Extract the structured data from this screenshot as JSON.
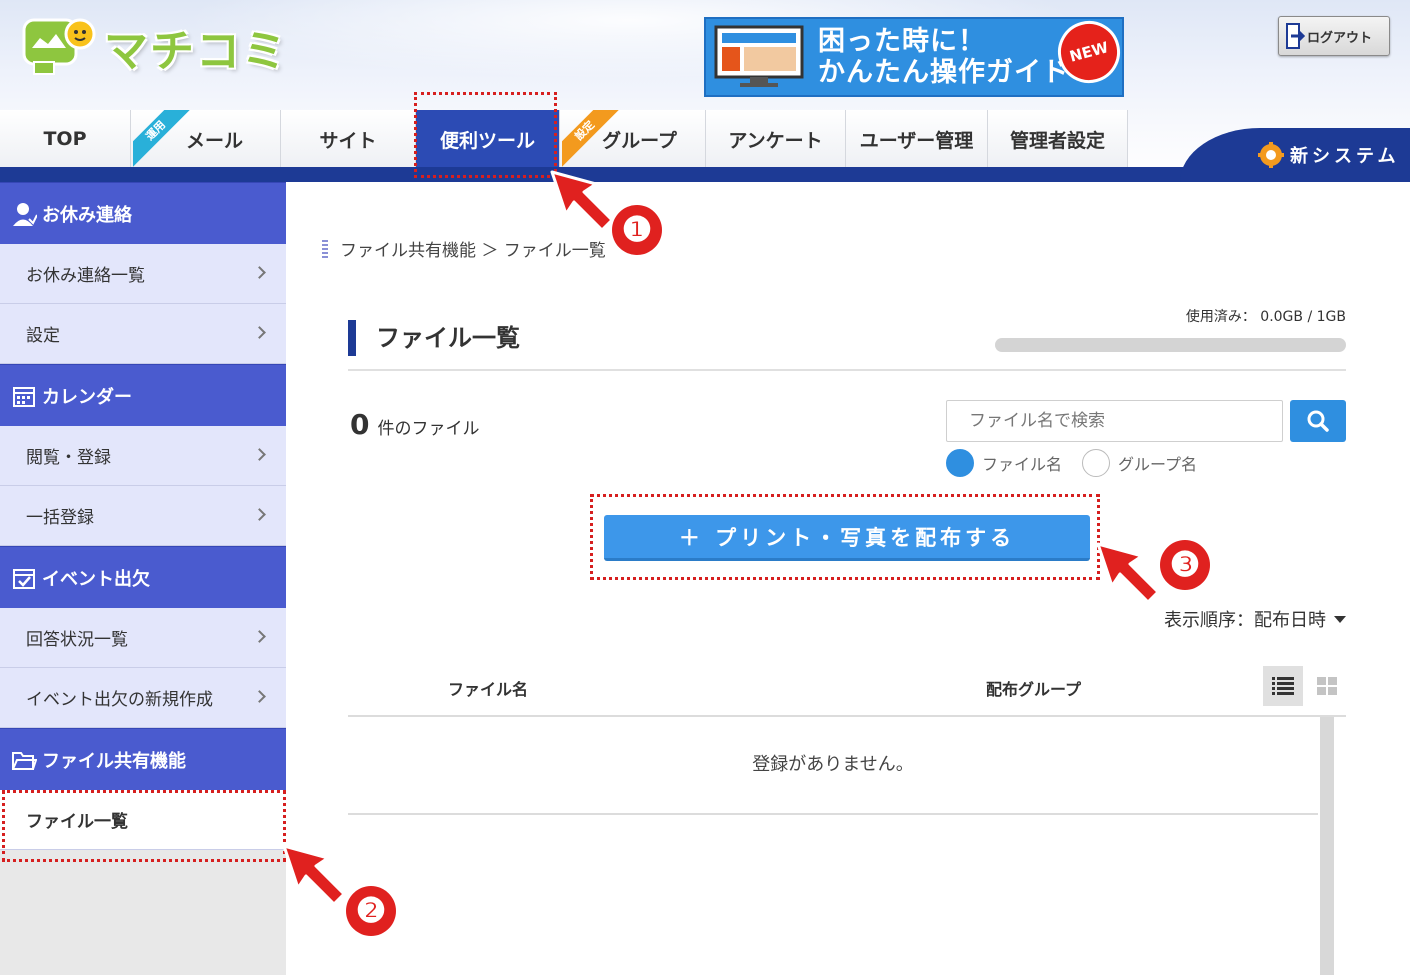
{
  "header": {
    "logo_text": "マチコミ",
    "banner": {
      "line1": "困った時に！",
      "line2": "かんたん操作ガイド",
      "new_badge": "NEW"
    },
    "logout_label": "ログアウト",
    "new_system_label": "新システム"
  },
  "nav": {
    "tabs": [
      {
        "label": "TOP",
        "ribbon": ""
      },
      {
        "label": "メール",
        "ribbon": "運用"
      },
      {
        "label": "サイト",
        "ribbon": ""
      },
      {
        "label": "便利ツール",
        "ribbon": "",
        "active": true
      },
      {
        "label": "グループ",
        "ribbon": "設定"
      },
      {
        "label": "アンケート",
        "ribbon": ""
      },
      {
        "label": "ユーザー管理",
        "ribbon": ""
      },
      {
        "label": "管理者設定",
        "ribbon": ""
      }
    ]
  },
  "sidebar": {
    "sections": [
      {
        "title": "お休み連絡",
        "icon": "person-icon",
        "items": [
          "お休み連絡一覧",
          "設定"
        ]
      },
      {
        "title": "カレンダー",
        "icon": "calendar-icon",
        "items": [
          "閲覧・登録",
          "一括登録"
        ]
      },
      {
        "title": "イベント出欠",
        "icon": "calendar-check-icon",
        "items": [
          "回答状況一覧",
          "イベント出欠の新規作成"
        ]
      },
      {
        "title": "ファイル共有機能",
        "icon": "folder-icon",
        "items": [
          "ファイル一覧"
        ]
      }
    ]
  },
  "main": {
    "breadcrumb": "ファイル共有機能 ＞ ファイル一覧",
    "title": "ファイル一覧",
    "usage": {
      "label": "使用済み： 0.0GB / 1GB",
      "fraction": 0
    },
    "file_count": "0",
    "file_count_suffix": "件のファイル",
    "search": {
      "placeholder": "ファイル名で検索",
      "options": [
        "ファイル名",
        "グループ名"
      ],
      "selected": "ファイル名"
    },
    "distribute_button": "＋ プリント・写真を配布する",
    "sort": "表示順序：配布日時",
    "table": {
      "columns": [
        "ファイル名",
        "配布グループ"
      ],
      "empty_message": "登録がありません。"
    }
  },
  "annotations": {
    "badges": [
      "❶",
      "❷",
      "❸"
    ],
    "color": "#d61f1f"
  },
  "colors": {
    "nav_dark": "#1d3a95",
    "sidebar_head": "#4a5bcf",
    "sidebar_item": "#e3e6fb",
    "accent_blue": "#2f8fe0"
  }
}
